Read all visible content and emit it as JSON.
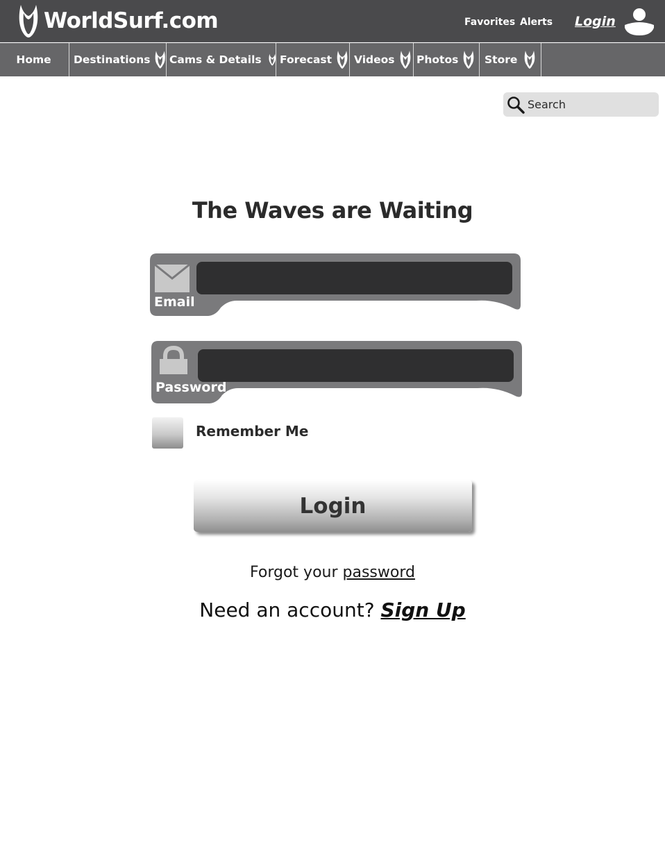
{
  "header": {
    "site_name": "WorldSurf.com",
    "logo_icon": "surfboard-fin-icon",
    "links": [
      "Favorites",
      "Alerts"
    ],
    "login_label": "Login",
    "avatar_icon": "user-avatar-icon"
  },
  "nav": {
    "items": [
      {
        "label": "Home",
        "has_dropdown": false
      },
      {
        "label": "Destinations",
        "has_dropdown": true
      },
      {
        "label": "Cams & Details",
        "has_dropdown": true
      },
      {
        "label": "Forecast",
        "has_dropdown": true
      },
      {
        "label": "Videos",
        "has_dropdown": true
      },
      {
        "label": "Photos",
        "has_dropdown": true
      },
      {
        "label": "Store",
        "has_dropdown": true
      }
    ]
  },
  "search": {
    "placeholder": "Search",
    "icon": "search-icon"
  },
  "login_form": {
    "heading": "The Waves are Waiting",
    "email_label": "Email",
    "email_icon": "envelope-icon",
    "email_value": "",
    "password_label": "Password",
    "password_icon": "lock-icon",
    "password_value": "",
    "remember_label": "Remember Me",
    "remember_checked": false,
    "submit_label": "Login"
  },
  "links": {
    "forgot_prefix": "Forgot your ",
    "forgot_link": "password",
    "signup_prefix": "Need an account? ",
    "signup_link": "Sign Up"
  },
  "colors": {
    "header_bg": "#4a4a4c",
    "nav_bg": "#666668",
    "field_bg": "#7a7a7c",
    "input_bg": "#2f2f30",
    "text_dark": "#2b2b2b"
  }
}
